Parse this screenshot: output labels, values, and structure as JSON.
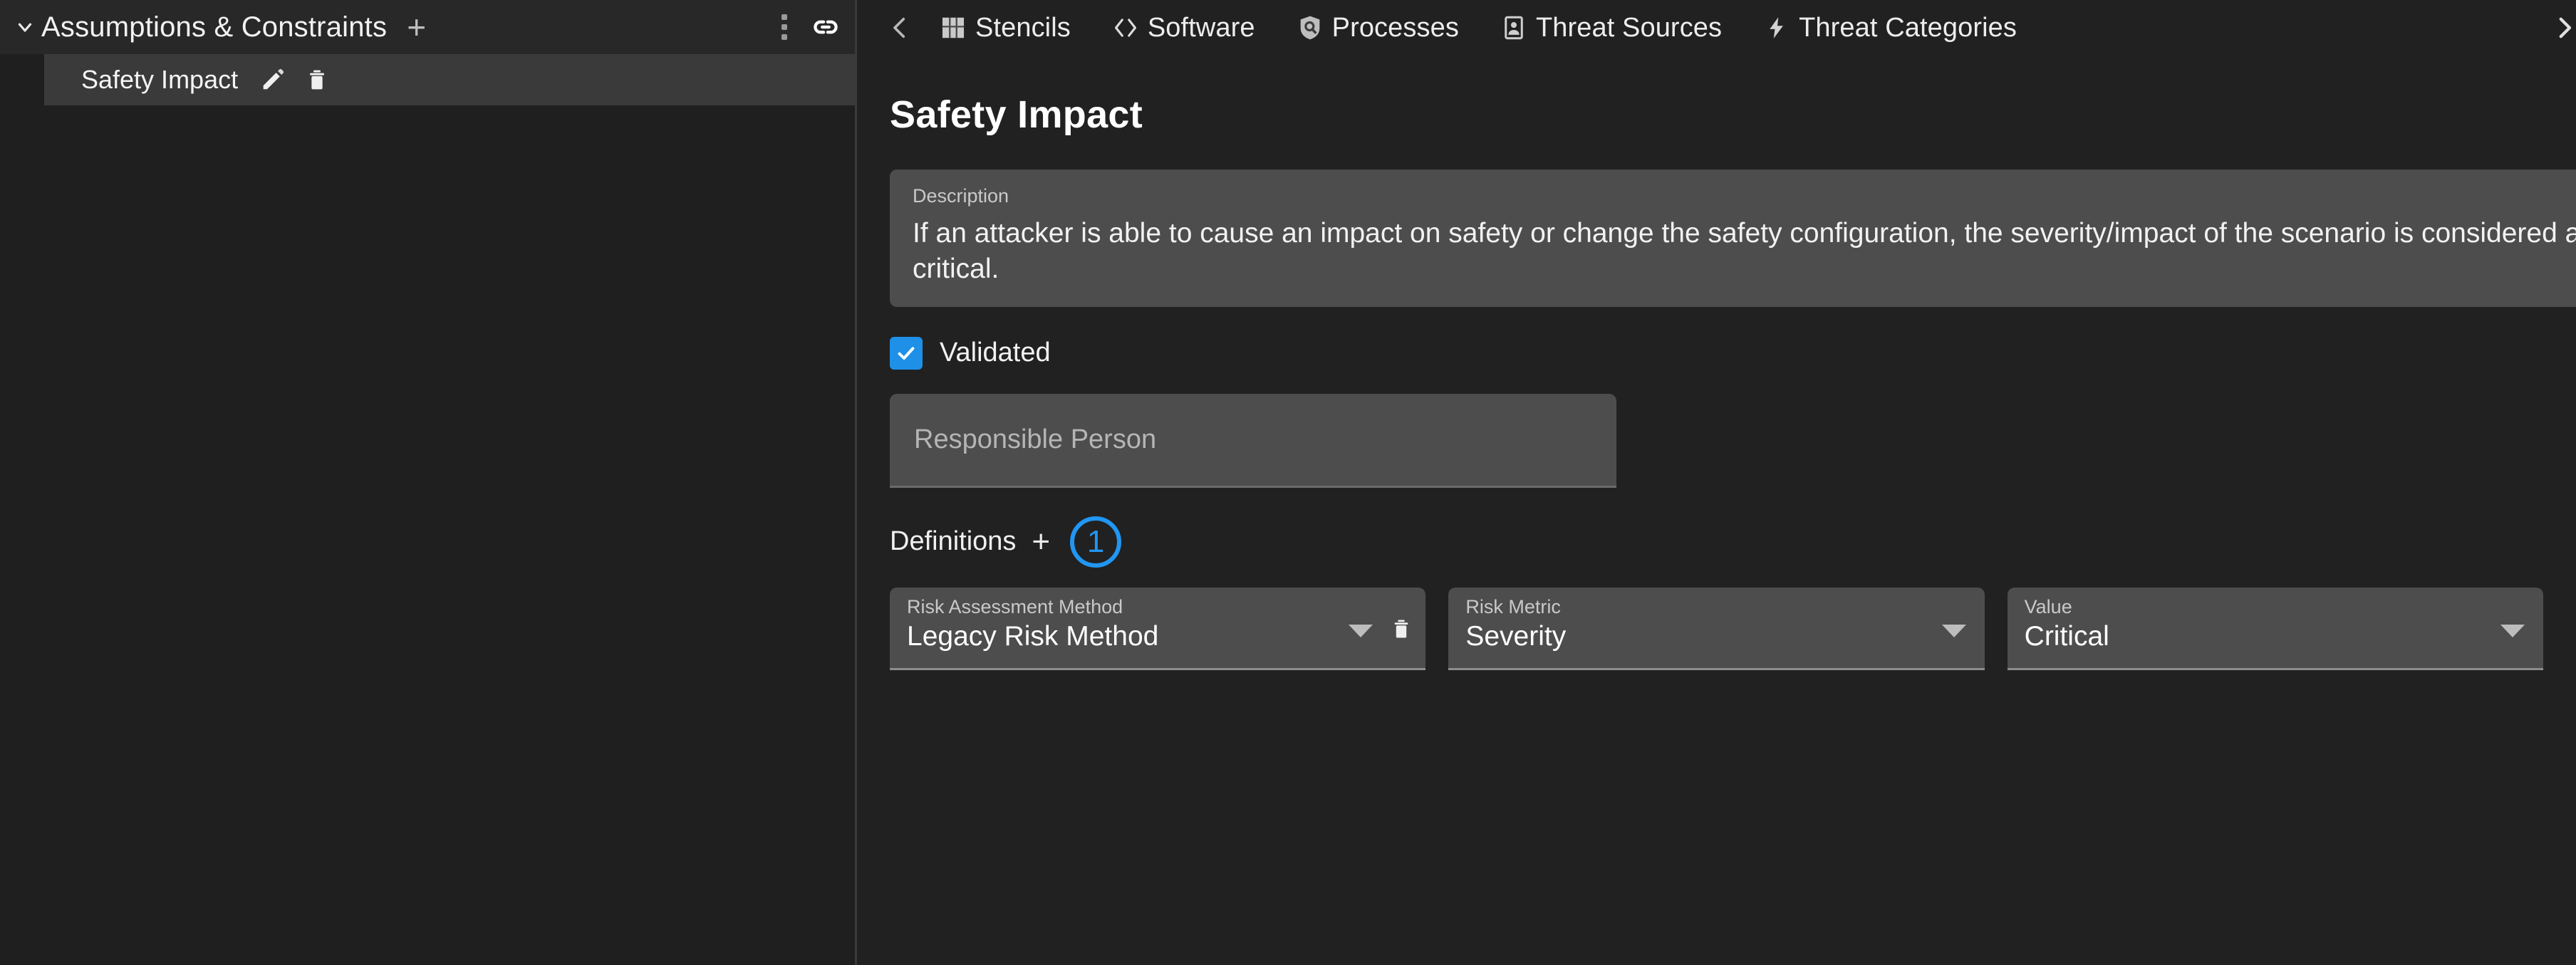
{
  "sidebar": {
    "header": {
      "title": "Assumptions & Constraints",
      "add_label": "+",
      "menu_icon": "more-vertical-icon",
      "link_icon": "link-icon",
      "caret_icon": "chevron-down-icon"
    },
    "items": [
      {
        "label": "Safety Impact",
        "edit_icon": "pencil-icon",
        "delete_icon": "trash-icon",
        "selected": true
      }
    ]
  },
  "toolbar": {
    "back_icon": "chevron-left-icon",
    "next_icon": "chevron-right-icon",
    "items": [
      {
        "label": "Stencils",
        "icon": "grid-icon"
      },
      {
        "label": "Software",
        "icon": "code-brackets-icon"
      },
      {
        "label": "Processes",
        "icon": "shield-search-icon"
      },
      {
        "label": "Threat Sources",
        "icon": "person-badge-icon"
      },
      {
        "label": "Threat Categories",
        "icon": "lightning-bolt-icon"
      }
    ]
  },
  "main": {
    "title": "Safety Impact",
    "description": {
      "label": "Description",
      "text": "If an attacker is able to cause an impact on safety or change the safety configuration, the severity/impact of the scenario is considered as critical."
    },
    "validated": {
      "label": "Validated",
      "checked": true,
      "check_glyph": "✓"
    },
    "responsible_person": {
      "placeholder": "Responsible Person",
      "value": ""
    },
    "definitions": {
      "label": "Definitions",
      "add_label": "+",
      "annotation": "1",
      "fields": [
        {
          "label": "Risk Assessment Method",
          "value": "Legacy Risk Method",
          "has_delete": true,
          "caret_icon": "chevron-down-icon",
          "delete_icon": "trash-icon"
        },
        {
          "label": "Risk Metric",
          "value": "Severity",
          "has_delete": false,
          "caret_icon": "chevron-down-icon"
        },
        {
          "label": "Value",
          "value": "Critical",
          "has_delete": false,
          "caret_icon": "chevron-down-icon"
        }
      ]
    }
  },
  "colors": {
    "accent_blue": "#1e90e8",
    "annotation_blue": "#2196f3",
    "panel_bg": "#212121",
    "sidebar_bg": "#1f1f1f",
    "card_bg": "#4d4d4d",
    "row_selected_bg": "#3a3a3a"
  }
}
